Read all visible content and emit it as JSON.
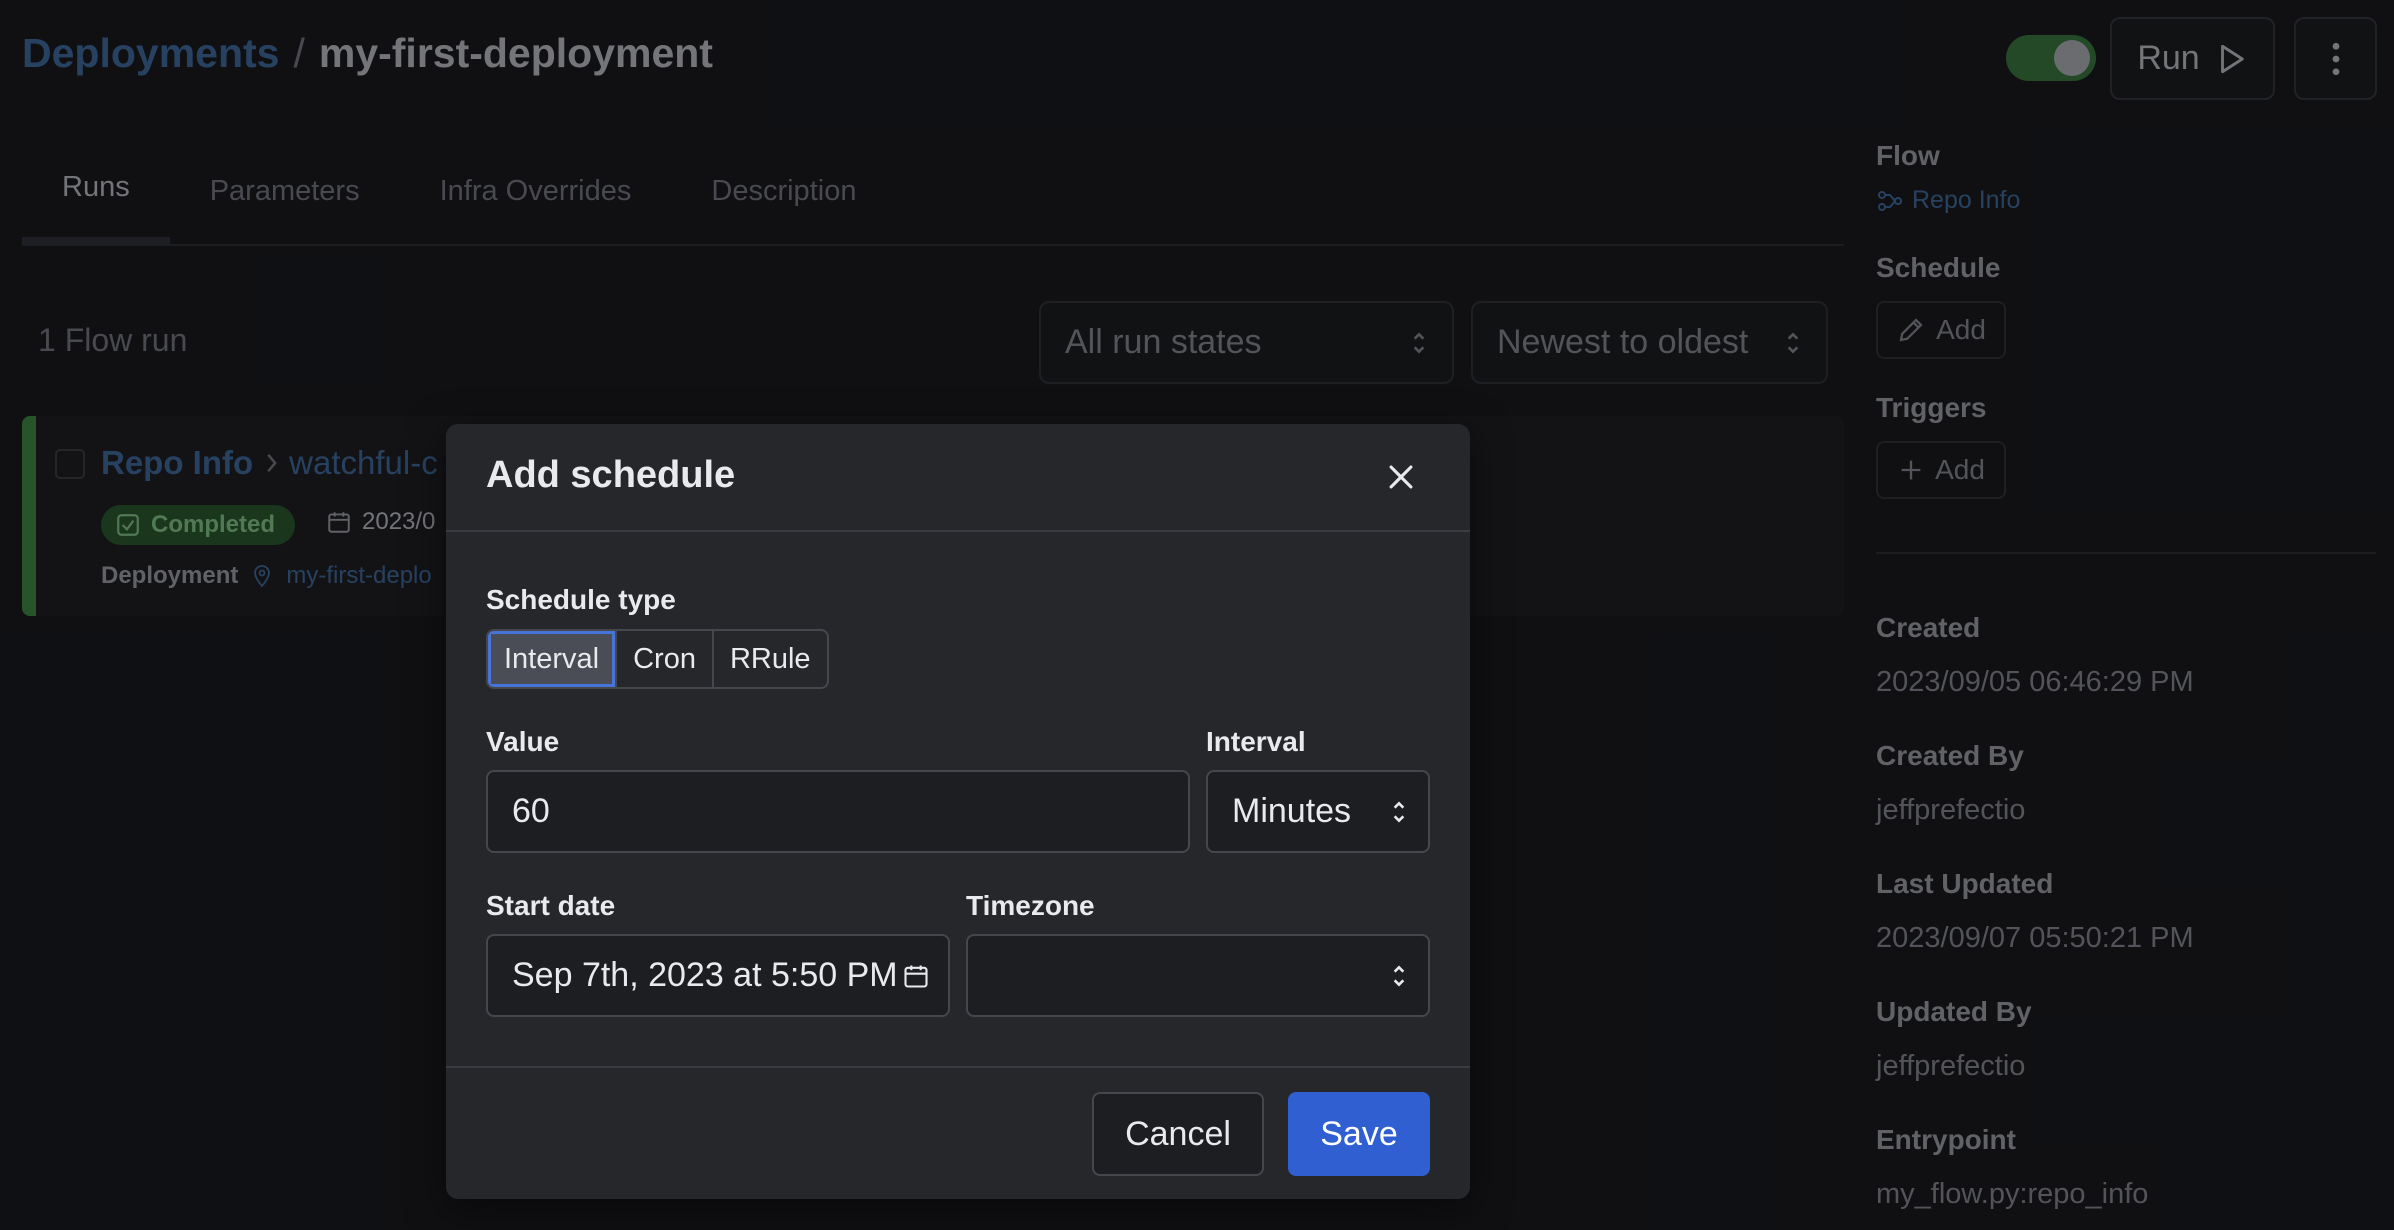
{
  "header": {
    "breadcrumb_root": "Deployments",
    "breadcrumb_sep": "/",
    "breadcrumb_current": "my-first-deployment",
    "run_label": "Run",
    "toggle_on": true
  },
  "tabs": [
    {
      "label": "Runs",
      "active": true
    },
    {
      "label": "Parameters"
    },
    {
      "label": "Infra Overrides"
    },
    {
      "label": "Description"
    }
  ],
  "runs": {
    "count_label": "1 Flow run",
    "state_filter": "All run states",
    "sort": "Newest to oldest",
    "card": {
      "flow_name": "Repo Info",
      "run_name": "watchful-c",
      "state": "Completed",
      "date": "2023/0",
      "deployment_label": "Deployment",
      "deployment_value": "my-first-deplo"
    }
  },
  "sidebar": {
    "flow_heading": "Flow",
    "flow_link": "Repo Info",
    "schedule_heading": "Schedule",
    "schedule_add": "Add",
    "triggers_heading": "Triggers",
    "triggers_add": "Add",
    "created_heading": "Created",
    "created_value": "2023/09/05 06:46:29 PM",
    "created_by_heading": "Created By",
    "created_by_value": "jeffprefectio",
    "last_updated_heading": "Last Updated",
    "last_updated_value": "2023/09/07 05:50:21 PM",
    "updated_by_heading": "Updated By",
    "updated_by_value": "jeffprefectio",
    "entrypoint_heading": "Entrypoint",
    "entrypoint_value": "my_flow.py:repo_info"
  },
  "modal": {
    "title": "Add schedule",
    "schedule_type_label": "Schedule type",
    "schedule_types": [
      "Interval",
      "Cron",
      "RRule"
    ],
    "selected_type": "Interval",
    "value_label": "Value",
    "value": "60",
    "interval_label": "Interval",
    "interval_value": "Minutes",
    "start_date_label": "Start date",
    "start_date_value": "Sep 7th, 2023 at 5:50 PM",
    "timezone_label": "Timezone",
    "timezone_value": "",
    "cancel_label": "Cancel",
    "save_label": "Save"
  },
  "colors": {
    "accent": "#2f5fd0",
    "link": "#3f6fa5",
    "success": "#3f9142"
  }
}
